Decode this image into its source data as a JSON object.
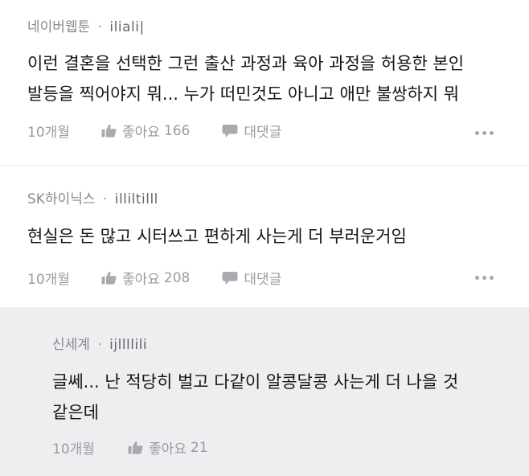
{
  "comments": [
    {
      "author": "네이버웹툰",
      "separator": "·",
      "user_id": "iliali|",
      "text": "이런 결혼을 선택한 그런 출산 과정과 육아 과정을 허용한 본인\n발등을 찍어야지 뭐... 누가 떠민것도 아니고 애만 불쌍하지 뭐",
      "time": "10개월",
      "like_label": "좋아요",
      "like_count": "166",
      "reply_label": "대댓글"
    },
    {
      "author": "SK하이닉스",
      "separator": "·",
      "user_id": "illiltilll",
      "text": "현실은 돈 많고 시터쓰고 편하게 사는게 더 부러운거임",
      "time": "10개월",
      "like_label": "좋아요",
      "like_count": "208",
      "reply_label": "대댓글"
    },
    {
      "author": "신세계",
      "separator": "·",
      "user_id": "ijllllili",
      "text": "글쎄... 난 적당히 벌고 다같이 알콩달콩 사는게 더 나을 것\n같은데",
      "time": "10개월",
      "like_label": "좋아요",
      "like_count": "21"
    }
  ],
  "icons": {
    "like": "thumbs-up-icon",
    "reply": "speech-bubble-icon",
    "more": "more-dots-icon"
  },
  "colors": {
    "reply_background": "#eeeef0",
    "meta_text": "#9a9aa2",
    "body_text": "#151515"
  }
}
